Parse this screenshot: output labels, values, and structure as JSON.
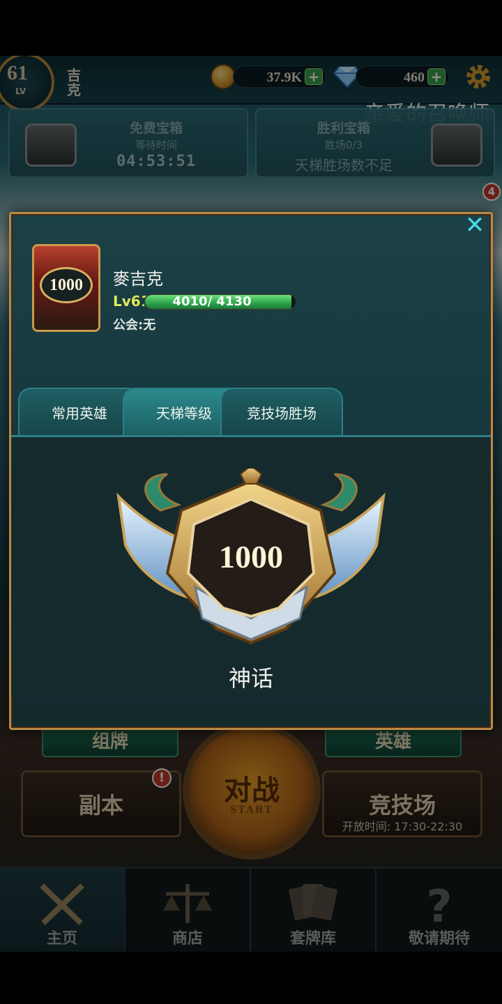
{
  "topbar": {
    "level": "61",
    "level_label": "LV",
    "player_name_short": "吉克",
    "gold": "37.9K",
    "gems": "460",
    "plus": "+",
    "toast": "亲爱的召唤师"
  },
  "chests": {
    "free": {
      "title": "免费宝箱",
      "subtitle": "等待时间",
      "timer": "04:53:51"
    },
    "victory": {
      "title": "胜利宝箱",
      "subtitle": "胜场0/3",
      "status": "天梯胜场数不足"
    },
    "event_badge": "4"
  },
  "profile_modal": {
    "close": "✕",
    "portrait_score": "1000",
    "name": "麥吉克",
    "level": "Lv61",
    "xp_text": "4010/ 4130",
    "xp_current": 4010,
    "xp_max": 4130,
    "guild": "公会:无",
    "tabs": [
      "常用英雄",
      "天梯等级",
      "竞技场胜场"
    ],
    "active_tab": 1,
    "rank_score": "1000",
    "rank_name": "神话"
  },
  "home": {
    "deck_button": "组牌",
    "hero_button": "英雄",
    "dungeon_button": "副本",
    "dungeon_badge": "!",
    "battle_label": "对战",
    "battle_sub": "START",
    "arena_button": "竞技场",
    "arena_time": "开放时间: 17:30-22:30"
  },
  "nav": {
    "items": [
      {
        "label": "主页",
        "icon": "crossed-swords-icon"
      },
      {
        "label": "商店",
        "icon": "scales-icon"
      },
      {
        "label": "套牌库",
        "icon": "cards-icon"
      },
      {
        "label": "敬请期待",
        "icon": "question-icon"
      }
    ],
    "active": 0
  },
  "colors": {
    "accent_cyan": "#4dd7e6",
    "gold_border": "#b98a46",
    "xp_green": "#2aa24a",
    "badge_red": "#c0392b"
  }
}
